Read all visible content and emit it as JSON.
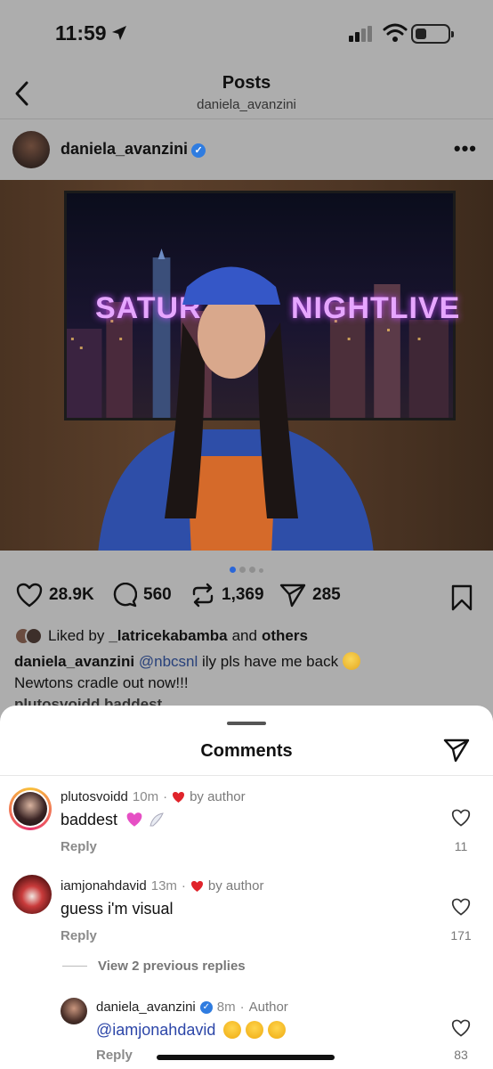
{
  "status_bar": {
    "time": "11:59"
  },
  "nav": {
    "title": "Posts",
    "subtitle": "daniela_avanzini"
  },
  "post": {
    "username": "daniela_avanzini",
    "photo_text_left": "SATUR",
    "photo_text_right": "NIGHTLIVE",
    "likes": "28.9K",
    "comments": "560",
    "reposts": "1,369",
    "shares": "285",
    "liked_by_prefix": "Liked by",
    "liked_by_user": "_latricekabamba",
    "liked_by_and": "and",
    "liked_by_others": "others",
    "caption_user": "daniela_avanzini",
    "caption_mention": "@nbcsnl",
    "caption_text": "ily pls have me back",
    "caption_line2": "Newtons cradle out now!!!",
    "peek_comment": "plutosvoidd baddest"
  },
  "comments_sheet": {
    "title": "Comments",
    "comments": [
      {
        "user": "plutosvoidd",
        "time": "10m",
        "liked_by": "by author",
        "text": "baddest",
        "reply_label": "Reply",
        "like_count": "11"
      },
      {
        "user": "iamjonahdavid",
        "time": "13m",
        "liked_by": "by author",
        "text": "guess i'm visual",
        "reply_label": "Reply",
        "like_count": "171",
        "view_replies": "View 2 previous replies"
      },
      {
        "user": "daniela_avanzini",
        "time": "8m",
        "tag": "Author",
        "mention": "@iamjonahdavid",
        "reply_label": "Reply",
        "like_count": "83"
      }
    ]
  },
  "colors": {
    "accent_blue": "#2f7ce0",
    "heart_red": "#e0242b",
    "mention_blue": "#2c46a8"
  }
}
